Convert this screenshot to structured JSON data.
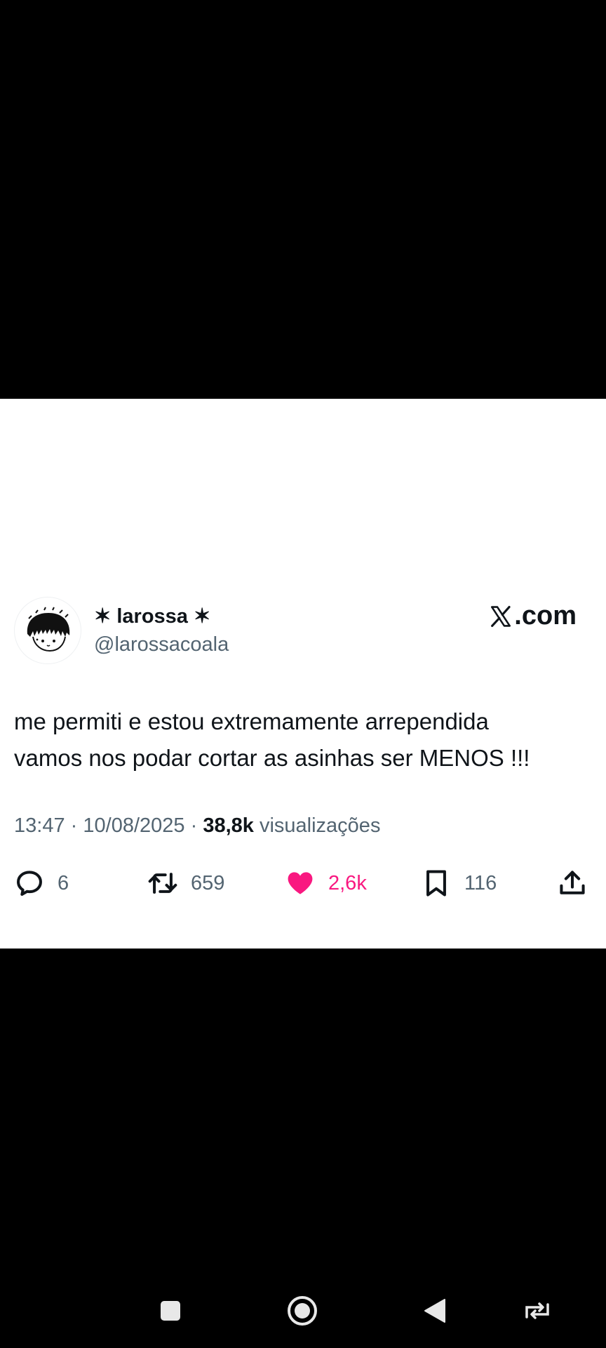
{
  "tweet": {
    "display_name": "✶ larossa ✶",
    "handle": "@larossacoala",
    "brand": ".com",
    "text_lines": [
      "me permiti e estou extremamente arrependida",
      "vamos nos podar cortar as asinhas ser MENOS !!!"
    ],
    "time": "13:47",
    "date": "10/08/2025",
    "separator": "·",
    "views_count": "38,8k",
    "views_label": "visualizações",
    "replies": "6",
    "retweets": "659",
    "likes": "2,6k",
    "bookmarks": "116"
  },
  "icons": {
    "reply": "reply-icon",
    "retweet": "retweet-icon",
    "like": "heart-icon",
    "bookmark": "bookmark-icon",
    "share": "share-icon",
    "brand": "x-logo-icon",
    "nav_recents": "recents-square-icon",
    "nav_home": "home-circle-icon",
    "nav_back": "back-triangle-icon",
    "nav_rotate": "rotate-icon"
  },
  "colors": {
    "text_primary": "#0f1419",
    "text_secondary": "#536471",
    "like": "#f91880",
    "background": "#000000",
    "card": "#ffffff"
  }
}
